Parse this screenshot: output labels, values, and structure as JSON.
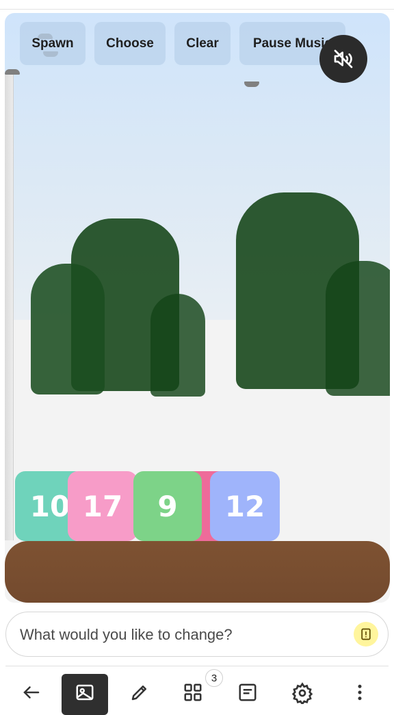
{
  "toolbar": {
    "spawn_label": "Spawn",
    "choose_label": "Choose",
    "clear_label": "Clear",
    "pause_music_label": "Pause Music"
  },
  "mute_button": {
    "icon": "speaker-muted-icon",
    "color": "#2b2b2b"
  },
  "tiles": [
    {
      "value": "10",
      "color": "#6fd3bb"
    },
    {
      "value": "17",
      "color": "#f79cc8"
    },
    {
      "value": "9",
      "color": "#7dd388"
    },
    {
      "value": "12",
      "color": "#9fb4fb"
    }
  ],
  "hidden_tile_color": "#ee6b9a",
  "platform_color": "#7a4e30",
  "bush_color": "#1b4d20",
  "prompt": {
    "placeholder": "What would you like to change?",
    "icon": "warning-icon"
  },
  "bottom_nav": {
    "items": [
      {
        "icon": "back-arrow-icon"
      },
      {
        "icon": "image-icon",
        "active": true
      },
      {
        "icon": "pencil-icon"
      },
      {
        "icon": "grid-icon",
        "badge": "3"
      },
      {
        "icon": "document-icon"
      },
      {
        "icon": "settings-gear-icon"
      },
      {
        "icon": "more-vertical-icon"
      }
    ]
  }
}
